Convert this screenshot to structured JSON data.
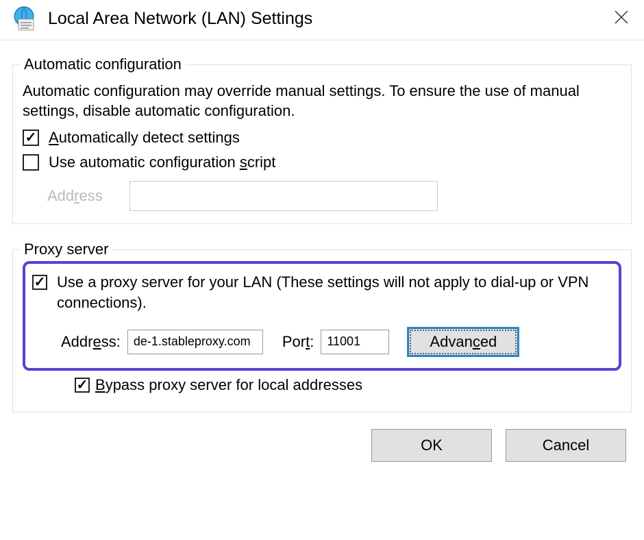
{
  "window": {
    "title": "Local Area Network (LAN) Settings",
    "close_icon": "close-icon"
  },
  "autoconfig": {
    "legend": "Automatic configuration",
    "description": "Automatic configuration may override manual settings.  To ensure the use of manual settings, disable automatic configuration.",
    "autodetect_label": "Automatically detect settings",
    "autodetect_checked": true,
    "usescript_label": "Use automatic configuration script",
    "usescript_checked": false,
    "script_address_label": "Address",
    "script_address_value": ""
  },
  "proxy": {
    "legend": "Proxy server",
    "useproxy_label": "Use a proxy server for your LAN (These settings will not apply to dial-up or VPN connections).",
    "useproxy_checked": true,
    "address_label": "Address:",
    "address_value": "de-1.stableproxy.com",
    "port_label": "Port:",
    "port_value": "11001",
    "advanced_label": "Advanced",
    "bypass_label": "Bypass proxy server for local addresses",
    "bypass_checked": true
  },
  "buttons": {
    "ok": "OK",
    "cancel": "Cancel"
  }
}
